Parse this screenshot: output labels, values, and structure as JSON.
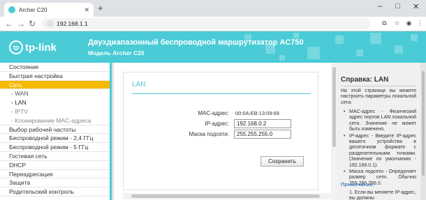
{
  "browser": {
    "tab_title": "Archer C20",
    "new_tab": "+",
    "url": "192.168.1.1"
  },
  "header": {
    "logo_text": "tp-link",
    "title": "Двухдиапазонный беспроводной маршрутизатор AC750",
    "subtitle": "Модель Archer C20"
  },
  "sidebar": {
    "items": [
      {
        "label": "Состояние"
      },
      {
        "label": "Быстрая настройка"
      },
      {
        "label": "Сеть"
      },
      {
        "label": "- WAN"
      },
      {
        "label": "- LAN"
      },
      {
        "label": "- IPTV"
      },
      {
        "label": "- Клонирование MAC-адреса"
      },
      {
        "label": "Выбор рабочей частоты"
      },
      {
        "label": "Беспроводной режим - 2,4 ГГц"
      },
      {
        "label": "Беспроводной режим - 5 ГГц"
      },
      {
        "label": "Гостевая сеть"
      },
      {
        "label": "DHCP"
      },
      {
        "label": "Переадресация"
      },
      {
        "label": "Защита"
      },
      {
        "label": "Родительский контроль"
      }
    ]
  },
  "main": {
    "section_title": "LAN",
    "mac_label": "MAC-адрес:",
    "mac_value": "00:0A:EB:13:09:69",
    "ip_label": "IP-адрес:",
    "ip_value": "192.168.0.2",
    "mask_label": "Маска подсети:",
    "mask_value": "255.255.255.0",
    "save_label": "Сохранить"
  },
  "help": {
    "title": "Справка: LAN",
    "intro": "На этой странице вы можете настроить параметры локальной сети.",
    "bullets": [
      "MAC-адрес - Физический адрес портов LAN локальной сети. Значение не может быть изменено.",
      "IP-адрес - Введите IP-адрес вашего устройства в десятичном формате с разделительными точками. (Значение по умолчанию - 192.168.0.1).",
      "Маска подсети - Определяет размер сети. Обычно 255.255.255.0."
    ],
    "note_label": "Примечание:",
    "note_item": "1. Если вы меняете IP-адрес, вы должны"
  }
}
